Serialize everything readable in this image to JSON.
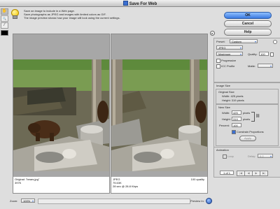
{
  "window": {
    "title": "Save For Web"
  },
  "tools": [
    {
      "name": "hand-tool-icon",
      "glyph": "✋"
    },
    {
      "name": "zoom-tool-icon",
      "glyph": "🔍"
    },
    {
      "name": "eyedropper-tool-icon",
      "glyph": "⁄"
    }
  ],
  "info": {
    "lines": [
      "Save an image to include in a Web page.",
      "Save photographs as JPEG and images with limited colors as GIF.",
      "The image preview shows how your image will look using the current settings."
    ]
  },
  "panes": [
    {
      "line1": "Original: \"bears.jpg\"",
      "line2": "397K",
      "line3": "",
      "right": ""
    },
    {
      "line1": "JPEG",
      "line2": "75.63K",
      "line3": "28 sec @ 28.8 Kbps",
      "right": "100 quality"
    }
  ],
  "buttons": {
    "ok": "OK",
    "cancel": "Cancel",
    "help": "Help"
  },
  "settings": {
    "preset_label": "Preset:",
    "preset_value": "Custom",
    "format_value": "JPEG",
    "quality_level": "Maximum",
    "quality_label": "Quality:",
    "quality_value": "100",
    "progressive_label": "Progressive",
    "icc_label": "ICC Profile",
    "matte_label": "Matte:"
  },
  "image_size": {
    "title": "Image Size",
    "original_title": "Original Size",
    "width_text": "Width: 425 pixels",
    "height_text": "Height: 319 pixels",
    "new_title": "New Size",
    "width_label": "Width:",
    "width_value": "425",
    "height_label": "Height:",
    "height_value": "319",
    "unit": "pixels",
    "percent_label": "Percent:",
    "percent_value": "100",
    "constrain_label": "Constrain Proportions",
    "apply_label": "Apply"
  },
  "animation": {
    "title": "Animation",
    "loop_label": "Loop",
    "delay_label": "Delay:",
    "delay_value": "0.2",
    "frame_counter": "1 of 1",
    "controls": [
      "|◀",
      "◀",
      "▶",
      "▶|"
    ]
  },
  "bottom": {
    "zoom_label": "Zoom:",
    "zoom_value": "100%",
    "preview_label": "Preview In:"
  },
  "colors": {
    "accent": "#3b6fd1",
    "ok_button": "#5a95f0",
    "matte_gray": "#a7a7a7"
  }
}
